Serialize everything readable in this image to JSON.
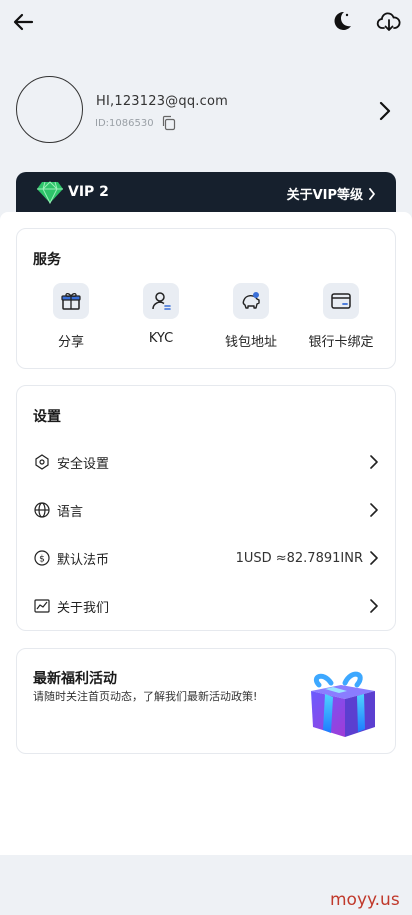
{
  "profile": {
    "email": "HI,123123@qq.com",
    "uid": "ID:1086530"
  },
  "vip": {
    "level": "VIP 2",
    "link": "关于VIP等级"
  },
  "services": {
    "title": "服务",
    "items": [
      {
        "label": "分享",
        "icon": "gift-icon"
      },
      {
        "label": "KYC",
        "icon": "user-verify-icon"
      },
      {
        "label": "钱包地址",
        "icon": "piggy-bank-icon"
      },
      {
        "label": "银行卡绑定",
        "icon": "bank-card-icon"
      }
    ]
  },
  "settings": {
    "title": "设置",
    "items": [
      {
        "label": "安全设置",
        "icon": "shield-icon",
        "value": ""
      },
      {
        "label": "语言",
        "icon": "globe-icon",
        "value": ""
      },
      {
        "label": "默认法币",
        "icon": "dollar-icon",
        "value": "1USD ≈82.7891INR"
      },
      {
        "label": "关于我们",
        "icon": "chart-icon",
        "value": ""
      }
    ]
  },
  "promo": {
    "title": "最新福利活动",
    "description": "请随时关注首页动态，了解我们最新活动政策!"
  },
  "watermark": "moyy.us",
  "colors": {
    "vip_bar": "#16202d",
    "page_bg": "#eef1f5",
    "icon_accent": "#3a6fd8"
  }
}
